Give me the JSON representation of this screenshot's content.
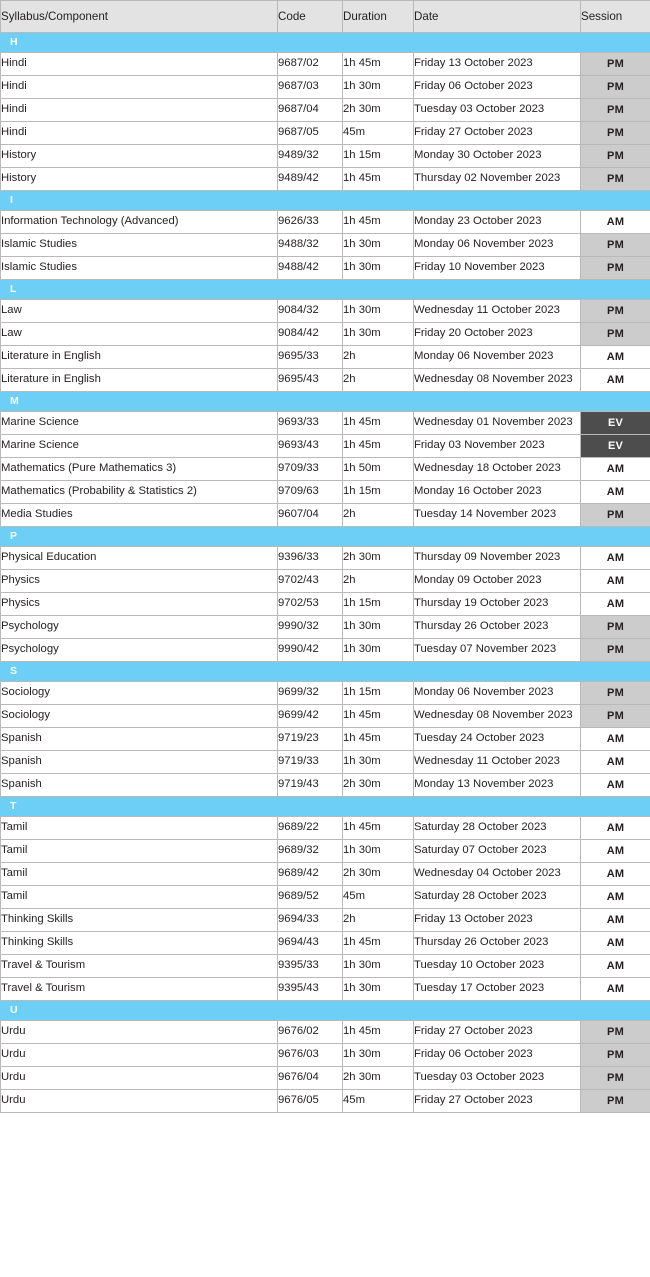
{
  "table": {
    "columns": [
      {
        "key": "syllabus",
        "label": "Syllabus/Component"
      },
      {
        "key": "code",
        "label": "Code"
      },
      {
        "key": "duration",
        "label": "Duration"
      },
      {
        "key": "date",
        "label": "Date"
      },
      {
        "key": "session",
        "label": "Session"
      }
    ],
    "colors": {
      "group_header_bg": "#6dcff6",
      "group_header_text": "#ffffff",
      "table_header_bg": "#e3e3e3",
      "border": "#b9b9b9",
      "session_am_bg": "#ffffff",
      "session_pm_bg": "#cccccc",
      "session_ev_bg": "#4d4d4d",
      "session_ev_text": "#ffffff",
      "text": "#231f20"
    },
    "groups": [
      {
        "letter": "H",
        "rows": [
          {
            "syllabus": "Hindi",
            "code": "9687/02",
            "duration": "1h 45m",
            "date": "Friday 13 October 2023",
            "session": "PM"
          },
          {
            "syllabus": "Hindi",
            "code": "9687/03",
            "duration": "1h 30m",
            "date": "Friday 06 October 2023",
            "session": "PM"
          },
          {
            "syllabus": "Hindi",
            "code": "9687/04",
            "duration": "2h 30m",
            "date": "Tuesday 03 October 2023",
            "session": "PM"
          },
          {
            "syllabus": "Hindi",
            "code": "9687/05",
            "duration": "45m",
            "date": "Friday 27 October 2023",
            "session": "PM"
          },
          {
            "syllabus": "History",
            "code": "9489/32",
            "duration": "1h 15m",
            "date": "Monday 30 October 2023",
            "session": "PM"
          },
          {
            "syllabus": "History",
            "code": "9489/42",
            "duration": "1h 45m",
            "date": "Thursday 02 November 2023",
            "session": "PM"
          }
        ]
      },
      {
        "letter": "I",
        "rows": [
          {
            "syllabus": "Information Technology (Advanced)",
            "code": "9626/33",
            "duration": "1h 45m",
            "date": "Monday 23 October 2023",
            "session": "AM"
          },
          {
            "syllabus": "Islamic Studies",
            "code": "9488/32",
            "duration": "1h 30m",
            "date": "Monday 06 November 2023",
            "session": "PM"
          },
          {
            "syllabus": "Islamic Studies",
            "code": "9488/42",
            "duration": "1h 30m",
            "date": "Friday 10 November 2023",
            "session": "PM"
          }
        ]
      },
      {
        "letter": "L",
        "rows": [
          {
            "syllabus": "Law",
            "code": "9084/32",
            "duration": "1h 30m",
            "date": "Wednesday 11 October 2023",
            "session": "PM"
          },
          {
            "syllabus": "Law",
            "code": "9084/42",
            "duration": "1h 30m",
            "date": "Friday 20 October 2023",
            "session": "PM"
          },
          {
            "syllabus": "Literature in English",
            "code": "9695/33",
            "duration": "2h",
            "date": "Monday 06 November 2023",
            "session": "AM"
          },
          {
            "syllabus": "Literature in English",
            "code": "9695/43",
            "duration": "2h",
            "date": "Wednesday 08 November 2023",
            "session": "AM"
          }
        ]
      },
      {
        "letter": "M",
        "rows": [
          {
            "syllabus": "Marine Science",
            "code": "9693/33",
            "duration": "1h 45m",
            "date": "Wednesday 01 November 2023",
            "session": "EV"
          },
          {
            "syllabus": "Marine Science",
            "code": "9693/43",
            "duration": "1h 45m",
            "date": "Friday 03 November 2023",
            "session": "EV"
          },
          {
            "syllabus": "Mathematics (Pure Mathematics 3)",
            "code": "9709/33",
            "duration": "1h 50m",
            "date": "Wednesday 18 October 2023",
            "session": "AM"
          },
          {
            "syllabus": "Mathematics (Probability & Statistics 2)",
            "code": "9709/63",
            "duration": "1h 15m",
            "date": "Monday 16 October 2023",
            "session": "AM"
          },
          {
            "syllabus": "Media Studies",
            "code": "9607/04",
            "duration": "2h",
            "date": "Tuesday 14 November 2023",
            "session": "PM"
          }
        ]
      },
      {
        "letter": "P",
        "rows": [
          {
            "syllabus": "Physical Education",
            "code": "9396/33",
            "duration": "2h 30m",
            "date": "Thursday 09 November 2023",
            "session": "AM"
          },
          {
            "syllabus": "Physics",
            "code": "9702/43",
            "duration": "2h",
            "date": "Monday 09 October 2023",
            "session": "AM"
          },
          {
            "syllabus": "Physics",
            "code": "9702/53",
            "duration": "1h 15m",
            "date": "Thursday 19 October 2023",
            "session": "AM"
          },
          {
            "syllabus": "Psychology",
            "code": "9990/32",
            "duration": "1h 30m",
            "date": "Thursday 26 October 2023",
            "session": "PM"
          },
          {
            "syllabus": "Psychology",
            "code": "9990/42",
            "duration": "1h 30m",
            "date": "Tuesday 07 November 2023",
            "session": "PM"
          }
        ]
      },
      {
        "letter": "S",
        "rows": [
          {
            "syllabus": "Sociology",
            "code": "9699/32",
            "duration": "1h 15m",
            "date": "Monday 06 November 2023",
            "session": "PM"
          },
          {
            "syllabus": "Sociology",
            "code": "9699/42",
            "duration": "1h 45m",
            "date": "Wednesday 08 November 2023",
            "session": "PM"
          },
          {
            "syllabus": "Spanish",
            "code": "9719/23",
            "duration": "1h 45m",
            "date": "Tuesday 24 October 2023",
            "session": "AM"
          },
          {
            "syllabus": "Spanish",
            "code": "9719/33",
            "duration": "1h 30m",
            "date": "Wednesday 11 October 2023",
            "session": "AM"
          },
          {
            "syllabus": "Spanish",
            "code": "9719/43",
            "duration": "2h 30m",
            "date": "Monday 13 November 2023",
            "session": "AM"
          }
        ]
      },
      {
        "letter": "T",
        "rows": [
          {
            "syllabus": "Tamil",
            "code": "9689/22",
            "duration": "1h 45m",
            "date": "Saturday 28 October 2023",
            "session": "AM"
          },
          {
            "syllabus": "Tamil",
            "code": "9689/32",
            "duration": "1h 30m",
            "date": "Saturday 07 October 2023",
            "session": "AM"
          },
          {
            "syllabus": "Tamil",
            "code": "9689/42",
            "duration": "2h 30m",
            "date": "Wednesday 04 October 2023",
            "session": "AM"
          },
          {
            "syllabus": "Tamil",
            "code": "9689/52",
            "duration": "45m",
            "date": "Saturday 28 October 2023",
            "session": "AM"
          },
          {
            "syllabus": "Thinking Skills",
            "code": "9694/33",
            "duration": "2h",
            "date": "Friday 13 October 2023",
            "session": "AM"
          },
          {
            "syllabus": "Thinking Skills",
            "code": "9694/43",
            "duration": "1h 45m",
            "date": "Thursday 26 October 2023",
            "session": "AM"
          },
          {
            "syllabus": "Travel & Tourism",
            "code": "9395/33",
            "duration": "1h 30m",
            "date": "Tuesday 10 October 2023",
            "session": "AM"
          },
          {
            "syllabus": "Travel & Tourism",
            "code": "9395/43",
            "duration": "1h 30m",
            "date": "Tuesday 17 October 2023",
            "session": "AM"
          }
        ]
      },
      {
        "letter": "U",
        "rows": [
          {
            "syllabus": "Urdu",
            "code": "9676/02",
            "duration": "1h 45m",
            "date": "Friday 27 October 2023",
            "session": "PM"
          },
          {
            "syllabus": "Urdu",
            "code": "9676/03",
            "duration": "1h 30m",
            "date": "Friday 06 October 2023",
            "session": "PM"
          },
          {
            "syllabus": "Urdu",
            "code": "9676/04",
            "duration": "2h 30m",
            "date": "Tuesday 03 October 2023",
            "session": "PM"
          },
          {
            "syllabus": "Urdu",
            "code": "9676/05",
            "duration": "45m",
            "date": "Friday 27 October 2023",
            "session": "PM"
          }
        ]
      }
    ]
  }
}
